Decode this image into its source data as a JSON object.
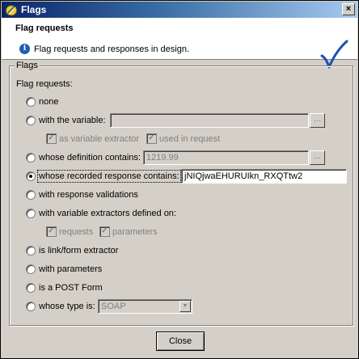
{
  "window": {
    "title": "Flags",
    "close_glyph": "×"
  },
  "header": {
    "title": "Flag requests",
    "description": "Flag requests and responses in design.",
    "info_glyph": "i"
  },
  "group": {
    "legend": "Flags",
    "intro": "Flag requests:"
  },
  "options": {
    "none": {
      "label": "none"
    },
    "with_variable": {
      "label": "with the variable:",
      "value": ""
    },
    "as_variable_extractor": {
      "label": "as variable extractor",
      "checked": true
    },
    "used_in_request": {
      "label": "used in request",
      "checked": true
    },
    "definition_contains": {
      "label": "whose definition contains:",
      "value": "1219.99"
    },
    "recorded_response_contains": {
      "label": "whose recorded response contains:",
      "value": "jNIQjwaEHURUIkn_RXQTtw2",
      "checked": true
    },
    "response_validations": {
      "label": "with response validations"
    },
    "variable_extractors_on": {
      "label": "with variable extractors defined on:"
    },
    "requests": {
      "label": "requests",
      "checked": true
    },
    "parameters": {
      "label": "parameters",
      "checked": true
    },
    "link_form_extractor": {
      "label": "is link/form extractor"
    },
    "with_parameters": {
      "label": "with parameters"
    },
    "post_form": {
      "label": "is a POST Form"
    },
    "type_is": {
      "label": "whose type is:",
      "value": "SOAP"
    }
  },
  "buttons": {
    "dots": "...",
    "check": "✓",
    "close": "Close",
    "combo_arrow": "▼"
  },
  "colors": {
    "title_start": "#0a246a",
    "title_end": "#a6caf0",
    "check_blue": "#1f4fb4",
    "face": "#d4d0c8"
  }
}
